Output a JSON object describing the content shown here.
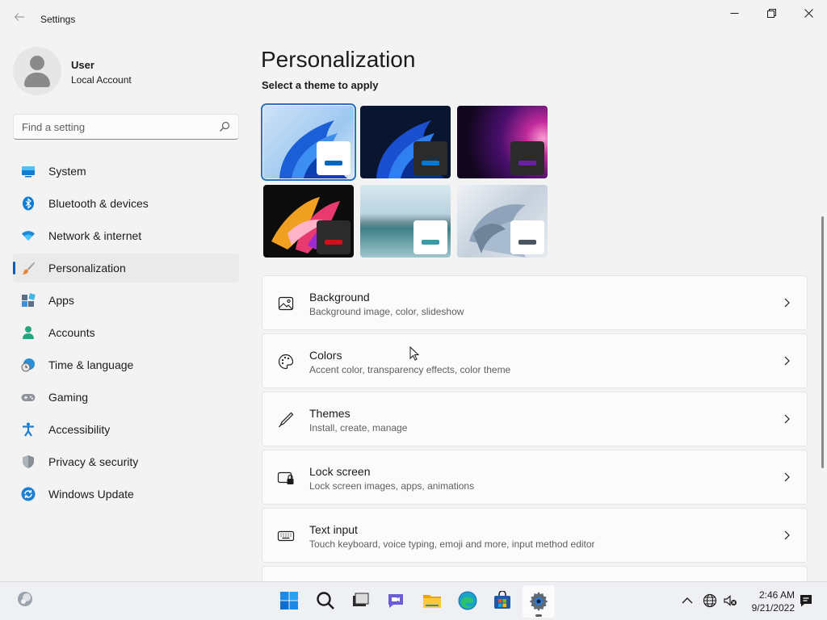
{
  "window": {
    "title": "Settings",
    "back_icon": "back-arrow-icon",
    "controls": [
      "minimize-icon",
      "maximize-icon",
      "close-icon"
    ]
  },
  "user": {
    "name": "User",
    "account_type": "Local Account"
  },
  "search": {
    "placeholder": "Find a setting",
    "icon": "search-icon"
  },
  "sidebar": {
    "items": [
      {
        "label": "System",
        "icon": "system-icon",
        "active": false
      },
      {
        "label": "Bluetooth & devices",
        "icon": "bluetooth-icon",
        "active": false
      },
      {
        "label": "Network & internet",
        "icon": "wifi-icon",
        "active": false
      },
      {
        "label": "Personalization",
        "icon": "brush-icon",
        "active": true
      },
      {
        "label": "Apps",
        "icon": "apps-icon",
        "active": false
      },
      {
        "label": "Accounts",
        "icon": "accounts-icon",
        "active": false
      },
      {
        "label": "Time & language",
        "icon": "time-language-icon",
        "active": false
      },
      {
        "label": "Gaming",
        "icon": "gamepad-icon",
        "active": false
      },
      {
        "label": "Accessibility",
        "icon": "accessibility-icon",
        "active": false
      },
      {
        "label": "Privacy & security",
        "icon": "shield-icon",
        "active": false
      },
      {
        "label": "Windows Update",
        "icon": "update-icon",
        "active": false
      }
    ]
  },
  "main": {
    "title": "Personalization",
    "themes_label": "Select a theme to apply",
    "themes": [
      {
        "name": "windows-light",
        "selected": true,
        "accent": "#0067c0"
      },
      {
        "name": "windows-dark",
        "selected": false,
        "accent": "#0078d4"
      },
      {
        "name": "glow",
        "selected": false,
        "accent": "#6b1fa3"
      },
      {
        "name": "captured-motion",
        "selected": false,
        "accent": "#d1101a"
      },
      {
        "name": "sunrise",
        "selected": false,
        "accent": "#3a9aa5"
      },
      {
        "name": "flow",
        "selected": false,
        "accent": "#4a5560"
      }
    ],
    "cards": [
      {
        "title": "Background",
        "subtitle": "Background image, color, slideshow",
        "icon": "image-icon"
      },
      {
        "title": "Colors",
        "subtitle": "Accent color, transparency effects, color theme",
        "icon": "palette-icon"
      },
      {
        "title": "Themes",
        "subtitle": "Install, create, manage",
        "icon": "pen-icon"
      },
      {
        "title": "Lock screen",
        "subtitle": "Lock screen images, apps, animations",
        "icon": "lock-screen-icon"
      },
      {
        "title": "Text input",
        "subtitle": "Touch keyboard, voice typing, emoji and more, input method editor",
        "icon": "keyboard-icon"
      }
    ]
  },
  "taskbar": {
    "apps": [
      "start-icon",
      "search-icon",
      "task-view-icon",
      "chat-icon",
      "file-explorer-icon",
      "edge-icon",
      "store-icon",
      "settings-icon"
    ],
    "active_app": "settings-icon",
    "time": "2:46 AM",
    "date": "9/21/2022"
  },
  "colors": {
    "accent": "#005fb8",
    "background": "#f3f3f3",
    "card": "#fbfbfb"
  }
}
